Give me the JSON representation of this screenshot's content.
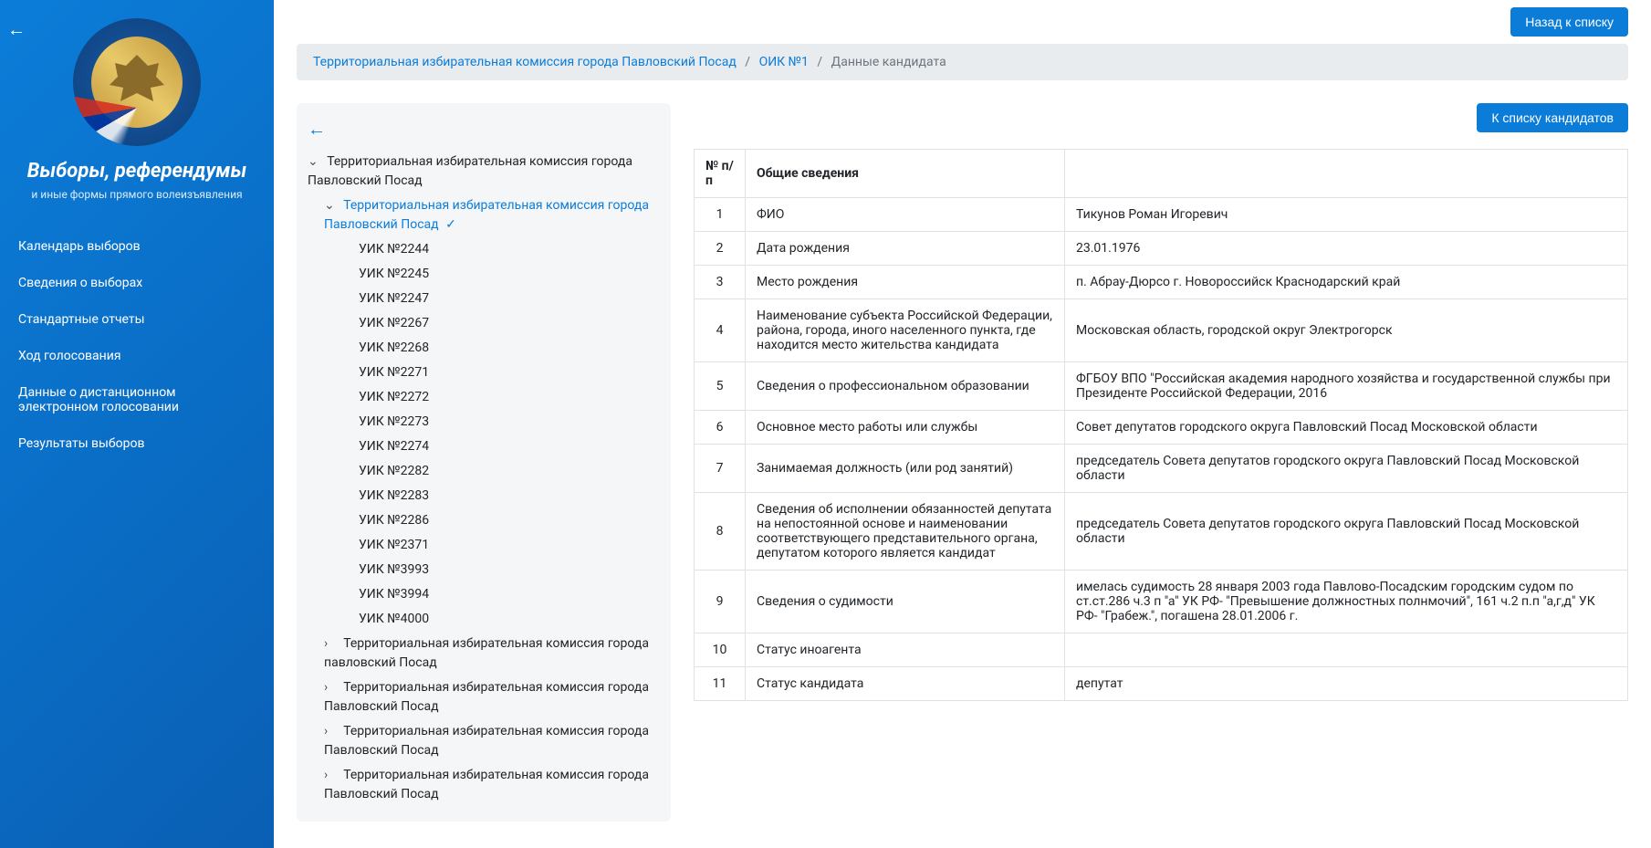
{
  "portal": {
    "title": "Выборы, референдумы",
    "subtitle": "и иные формы прямого волеизъявления"
  },
  "nav": {
    "calendar": "Календарь выборов",
    "info": "Сведения о выборах",
    "reports": "Стандартные отчеты",
    "progress": "Ход голосования",
    "remote": "Данные о дистанционном электронном голосовании",
    "results": "Результаты выборов"
  },
  "top_buttons": {
    "back_to_list": "Назад к списку",
    "to_candidates": "К списку кандидатов"
  },
  "breadcrumb": {
    "item1": "Территориальная избирательная комиссия города Павловский Посад",
    "item2": "ОИК №1",
    "current": "Данные кандидата"
  },
  "tree": {
    "root": "Территориальная избирательная комиссия города Павловский Посад",
    "active": "Территориальная избирательная комиссия города Павловский Посад",
    "uiks": [
      "УИК №2244",
      "УИК №2245",
      "УИК №2247",
      "УИК №2267",
      "УИК №2268",
      "УИК №2271",
      "УИК №2272",
      "УИК №2273",
      "УИК №2274",
      "УИК №2282",
      "УИК №2283",
      "УИК №2286",
      "УИК №2371",
      "УИК №3993",
      "УИК №3994",
      "УИК №4000"
    ],
    "siblings": [
      "Территориальная избирательная комиссия города павловский Посад",
      "Территориальная избирательная комиссия города Павловский Посад",
      "Территориальная избирательная комиссия города Павловский Посад",
      "Территориальная избирательная комиссия города Павловский Посад"
    ]
  },
  "table": {
    "head_num": "№ п/п",
    "head_label": "Общие сведения",
    "rows": [
      {
        "n": "1",
        "label": "ФИО",
        "value": "Тикунов Роман Игоревич"
      },
      {
        "n": "2",
        "label": "Дата рождения",
        "value": "23.01.1976"
      },
      {
        "n": "3",
        "label": "Место рождения",
        "value": "п. Абрау-Дюрсо г. Новороссийск Краснодарский край"
      },
      {
        "n": "4",
        "label": "Наименование субъекта Российской Федерации, района, города, иного населенного пункта, где находится место жительства кандидата",
        "value": "Московская область, городской округ Электрогорск"
      },
      {
        "n": "5",
        "label": "Сведения о профессиональном образовании",
        "value": "ФГБОУ ВПО \"Российская академия народного хозяйства и государственной службы при Президенте Российской Федерации, 2016"
      },
      {
        "n": "6",
        "label": "Основное место работы или службы",
        "value": "Совет депутатов городского округа Павловский Посад Московской области"
      },
      {
        "n": "7",
        "label": "Занимаемая должность (или род занятий)",
        "value": "председатель Совета депутатов городского округа Павловский Посад Московской области"
      },
      {
        "n": "8",
        "label": "Сведения об исполнении обязанностей депутата на непостоянной основе и наименовании соответствующего представительного органа, депутатом которого является кандидат",
        "value": "председатель Совета депутатов городского округа Павловский Посад Московской области"
      },
      {
        "n": "9",
        "label": "Сведения о судимости",
        "value": "имелась судимость 28 января 2003 года Павлово-Посадским городским судом по ст.ст.286 ч.3 п \"а\" УК РФ- \"Превышение должностных полнмочий\", 161 ч.2 п.п \"а,г,д\" УК РФ- \"Грабеж.\", погашена 28.01.2006 г."
      },
      {
        "n": "10",
        "label": "Статус иноагента",
        "value": ""
      },
      {
        "n": "11",
        "label": "Статус кандидата",
        "value": "депутат"
      }
    ]
  }
}
